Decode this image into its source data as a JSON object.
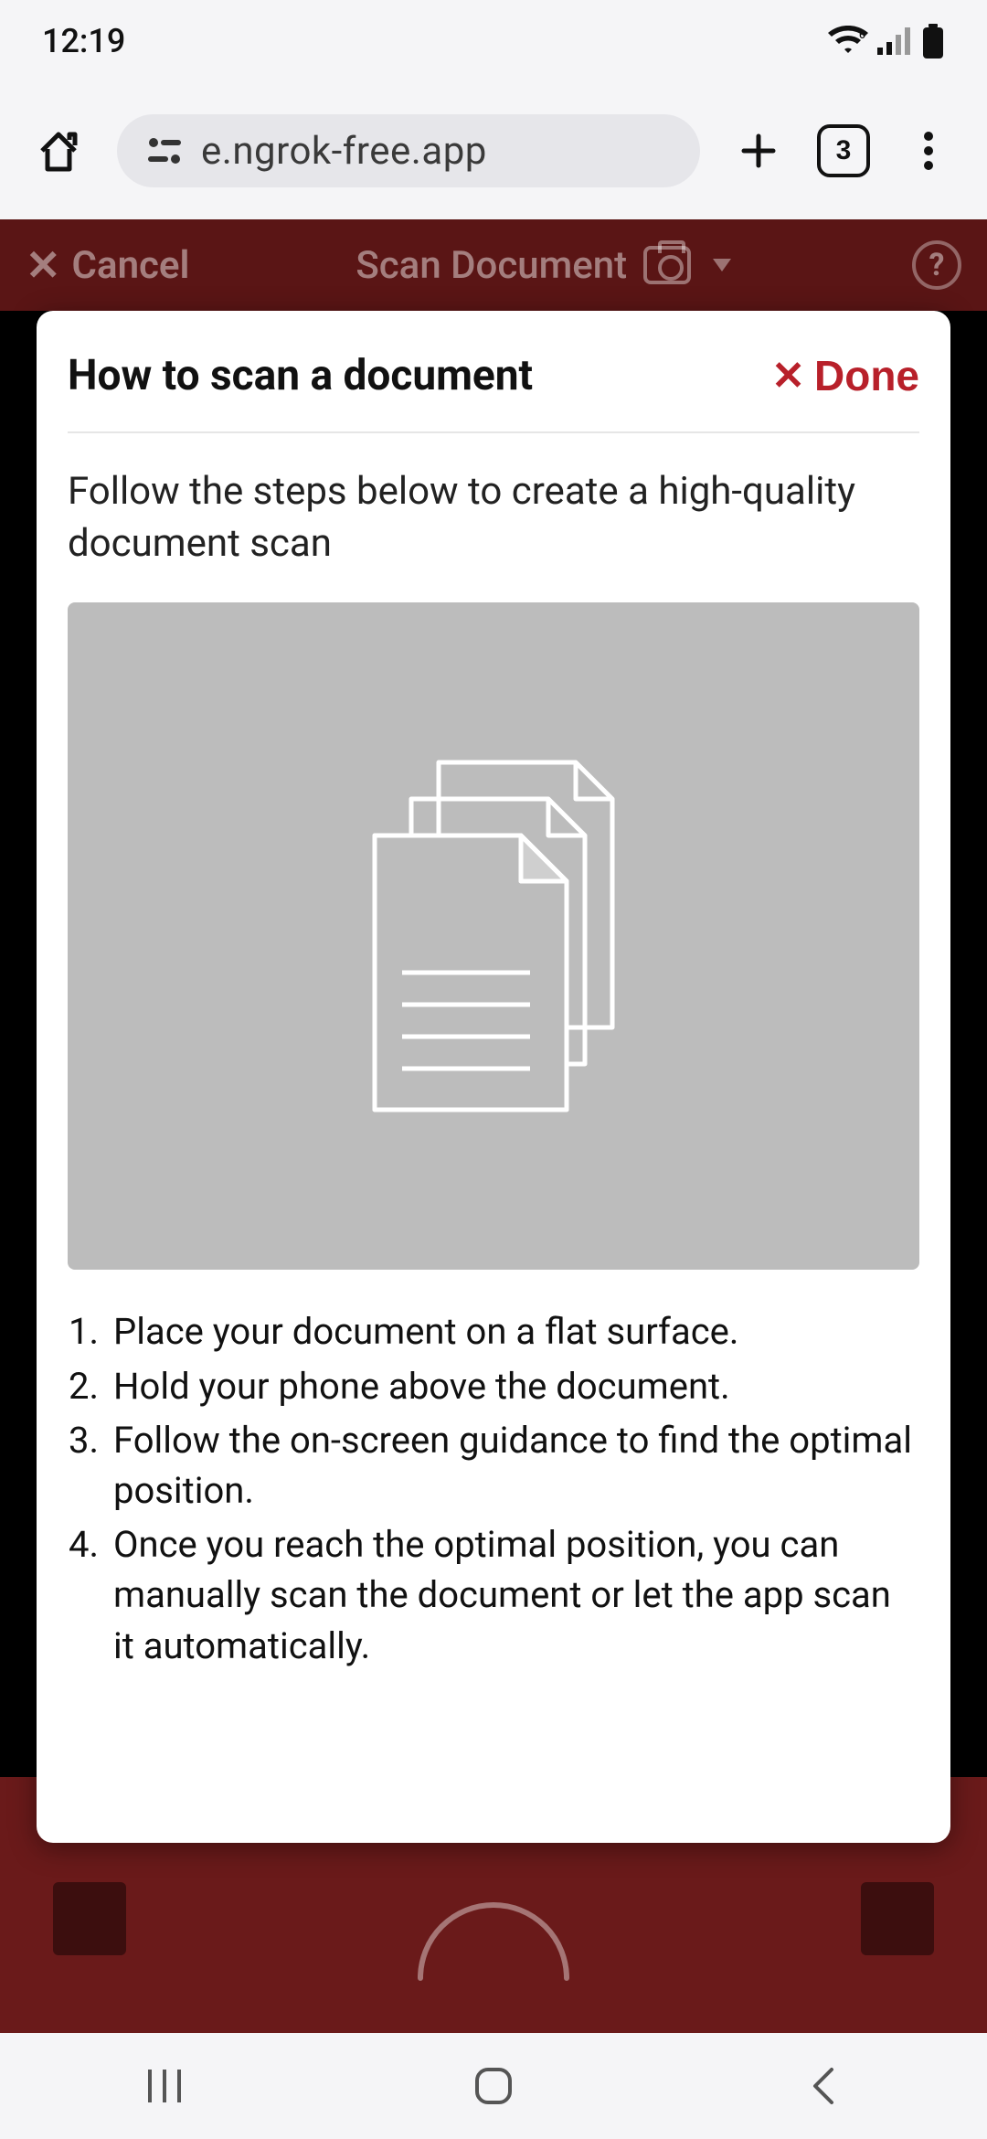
{
  "status": {
    "time": "12:19",
    "wifi_gen": "6"
  },
  "browser": {
    "url_display": "e.ngrok-free.app",
    "tab_count": "3"
  },
  "app_header": {
    "cancel_label": "Cancel",
    "title": "Scan Document"
  },
  "modal": {
    "title": "How to scan a document",
    "done_label": "Done",
    "intro": "Follow the steps below to create a high-quality document scan",
    "steps": [
      "Place your document on a flat surface.",
      "Hold your phone above the document.",
      "Follow the on-screen guidance to find the optimal position.",
      "Once you reach the optimal position, you can manually scan the document or let the app scan it automatically."
    ]
  }
}
